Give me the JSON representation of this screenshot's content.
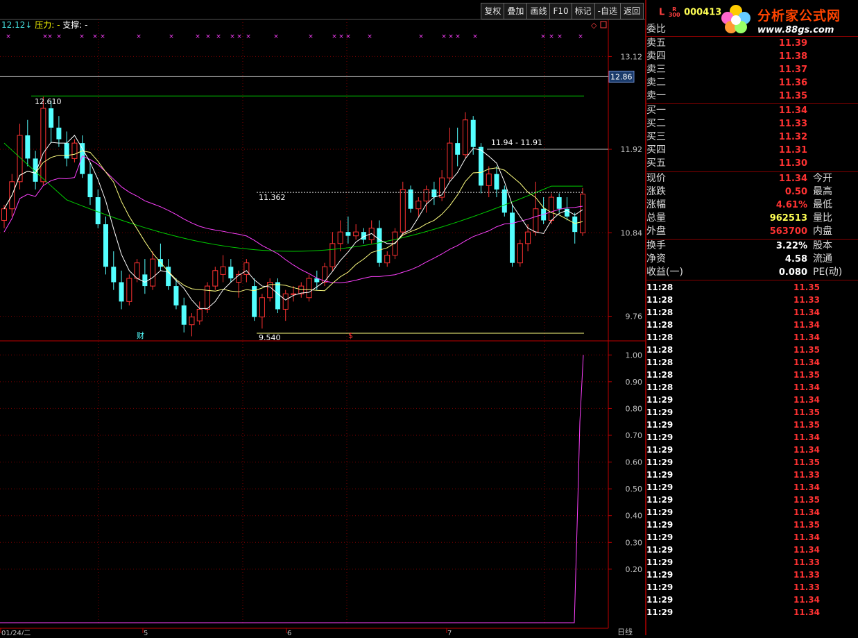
{
  "toolbar": [
    "复权",
    "叠加",
    "画线",
    "F10",
    "标记",
    "-自选",
    "返回"
  ],
  "legend": {
    "ma": "12.12↓",
    "pressure": "压力: -",
    "support": "支撑: -"
  },
  "markers": {
    "cai": "财",
    "dollar": "$"
  },
  "price_axis": [
    "13.12",
    "11.92",
    "10.84",
    "9.76"
  ],
  "current_price_tag": "12.86",
  "annotations": {
    "high": "12.610",
    "range": "11.94 - 11.91",
    "mid": "11.362",
    "low": "9.540"
  },
  "indicator_axis": [
    "1.00",
    "0.90",
    "0.80",
    "0.70",
    "0.60",
    "0.50",
    "0.40",
    "0.30",
    "0.20"
  ],
  "date_labels": [
    "01/24/二",
    "5",
    "6",
    "7"
  ],
  "period_label": "日线",
  "colors": {
    "up": "#ff3232",
    "down": "#54ffff",
    "ma5": "#ffffff",
    "ma10": "#ffff80",
    "ma20": "#ff40ff",
    "ma60": "#00cc00",
    "grid": "#800000"
  },
  "stock": {
    "prefix": "L",
    "badge_top": "R",
    "badge_bottom": "300",
    "code": "000413"
  },
  "logo": {
    "title": "分析家公式网",
    "url": "www.88gs.com"
  },
  "order_book": {
    "header": "委比",
    "sell": [
      {
        "label": "卖五",
        "price": "11.39"
      },
      {
        "label": "卖四",
        "price": "11.38"
      },
      {
        "label": "卖三",
        "price": "11.37"
      },
      {
        "label": "卖二",
        "price": "11.36"
      },
      {
        "label": "卖一",
        "price": "11.35"
      }
    ],
    "buy": [
      {
        "label": "买一",
        "price": "11.34"
      },
      {
        "label": "买二",
        "price": "11.33"
      },
      {
        "label": "买三",
        "price": "11.32"
      },
      {
        "label": "买四",
        "price": "11.31"
      },
      {
        "label": "买五",
        "price": "11.30"
      }
    ]
  },
  "quote": [
    {
      "label": "现价",
      "value": "11.34",
      "label2": "今开",
      "color": "#ff3232"
    },
    {
      "label": "涨跌",
      "value": "0.50",
      "label2": "最高",
      "color": "#ff3232"
    },
    {
      "label": "涨幅",
      "value": "4.61%",
      "label2": "最低",
      "color": "#ff3232"
    },
    {
      "label": "总量",
      "value": "962513",
      "label2": "量比",
      "color": "#ffff54"
    },
    {
      "label": "外盘",
      "value": "563700",
      "label2": "内盘",
      "color": "#ff3232"
    }
  ],
  "stats": [
    {
      "label": "换手",
      "value": "3.22%",
      "label2": "股本",
      "color": "#ffffff"
    },
    {
      "label": "净资",
      "value": "4.58",
      "label2": "流通",
      "color": "#ffffff"
    },
    {
      "label": "收益(一)",
      "value": "0.080",
      "label2": "PE(动)",
      "color": "#ffffff"
    }
  ],
  "ticks": [
    {
      "t": "11:28",
      "p": "11.35"
    },
    {
      "t": "11:28",
      "p": "11.33"
    },
    {
      "t": "11:28",
      "p": "11.34"
    },
    {
      "t": "11:28",
      "p": "11.34"
    },
    {
      "t": "11:28",
      "p": "11.34"
    },
    {
      "t": "11:28",
      "p": "11.35"
    },
    {
      "t": "11:28",
      "p": "11.34"
    },
    {
      "t": "11:28",
      "p": "11.35"
    },
    {
      "t": "11:28",
      "p": "11.34"
    },
    {
      "t": "11:29",
      "p": "11.34"
    },
    {
      "t": "11:29",
      "p": "11.35"
    },
    {
      "t": "11:29",
      "p": "11.35"
    },
    {
      "t": "11:29",
      "p": "11.34"
    },
    {
      "t": "11:29",
      "p": "11.34"
    },
    {
      "t": "11:29",
      "p": "11.35"
    },
    {
      "t": "11:29",
      "p": "11.33"
    },
    {
      "t": "11:29",
      "p": "11.34"
    },
    {
      "t": "11:29",
      "p": "11.35"
    },
    {
      "t": "11:29",
      "p": "11.34"
    },
    {
      "t": "11:29",
      "p": "11.35"
    },
    {
      "t": "11:29",
      "p": "11.34"
    },
    {
      "t": "11:29",
      "p": "11.34"
    },
    {
      "t": "11:29",
      "p": "11.33"
    },
    {
      "t": "11:29",
      "p": "11.33"
    },
    {
      "t": "11:29",
      "p": "11.33"
    },
    {
      "t": "11:29",
      "p": "11.34"
    },
    {
      "t": "11:29",
      "p": "11.34"
    }
  ],
  "chart_data": {
    "type": "candlestick",
    "price_ylim": [
      9.45,
      13.6
    ],
    "candles": [
      [
        11.0,
        11.2,
        10.9,
        11.15
      ],
      [
        11.15,
        11.6,
        11.05,
        11.5
      ],
      [
        11.5,
        12.25,
        11.4,
        12.1
      ],
      [
        12.1,
        12.3,
        11.7,
        11.8
      ],
      [
        11.8,
        11.9,
        11.4,
        11.5
      ],
      [
        11.5,
        12.6,
        11.45,
        12.45
      ],
      [
        12.45,
        12.55,
        12.0,
        12.2
      ],
      [
        12.2,
        12.35,
        11.95,
        12.05
      ],
      [
        12.0,
        12.15,
        11.7,
        11.8
      ],
      [
        11.8,
        12.05,
        11.75,
        12.0
      ],
      [
        12.0,
        12.1,
        11.55,
        11.6
      ],
      [
        11.6,
        11.75,
        11.2,
        11.3
      ],
      [
        11.3,
        11.4,
        10.9,
        10.95
      ],
      [
        10.95,
        11.05,
        10.3,
        10.4
      ],
      [
        10.4,
        10.6,
        10.1,
        10.2
      ],
      [
        10.2,
        10.35,
        9.85,
        9.95
      ],
      [
        9.95,
        10.3,
        9.9,
        10.25
      ],
      [
        10.25,
        10.5,
        10.2,
        10.45
      ],
      [
        10.3,
        10.5,
        10.05,
        10.15
      ],
      [
        10.15,
        10.6,
        10.1,
        10.5
      ],
      [
        10.5,
        10.7,
        10.35,
        10.4
      ],
      [
        10.4,
        10.5,
        10.1,
        10.15
      ],
      [
        10.15,
        10.25,
        9.85,
        9.9
      ],
      [
        9.9,
        10.0,
        9.55,
        9.65
      ],
      [
        9.65,
        9.8,
        9.5,
        9.75
      ],
      [
        9.7,
        9.95,
        9.65,
        9.85
      ],
      [
        9.85,
        10.2,
        9.8,
        10.15
      ],
      [
        10.15,
        10.4,
        10.1,
        10.35
      ],
      [
        10.3,
        10.55,
        10.2,
        10.4
      ],
      [
        10.4,
        10.5,
        10.2,
        10.25
      ],
      [
        10.2,
        10.35,
        10.0,
        10.3
      ],
      [
        10.3,
        10.5,
        10.2,
        10.45
      ],
      [
        10.15,
        10.25,
        9.7,
        9.75
      ],
      [
        9.75,
        10.05,
        9.6,
        10.0
      ],
      [
        10.0,
        10.25,
        9.95,
        10.2
      ],
      [
        10.2,
        10.25,
        9.8,
        9.85
      ],
      [
        9.85,
        10.1,
        9.7,
        10.05
      ],
      [
        10.05,
        10.15,
        9.95,
        10.05
      ],
      [
        10.05,
        10.2,
        10.0,
        10.15
      ],
      [
        10.0,
        10.3,
        9.95,
        10.25
      ],
      [
        10.25,
        10.35,
        10.1,
        10.2
      ],
      [
        10.2,
        10.45,
        10.15,
        10.4
      ],
      [
        10.4,
        10.85,
        10.35,
        10.7
      ],
      [
        10.7,
        11.0,
        10.6,
        10.85
      ],
      [
        10.85,
        11.05,
        10.7,
        10.8
      ],
      [
        10.8,
        10.95,
        10.75,
        10.85
      ],
      [
        10.85,
        10.9,
        10.7,
        10.75
      ],
      [
        10.75,
        11.0,
        10.7,
        10.9
      ],
      [
        10.9,
        11.0,
        10.4,
        10.45
      ],
      [
        10.45,
        10.6,
        10.4,
        10.55
      ],
      [
        10.55,
        10.9,
        10.5,
        10.85
      ],
      [
        10.85,
        11.5,
        10.8,
        11.4
      ],
      [
        11.4,
        11.45,
        11.1,
        11.15
      ],
      [
        11.15,
        11.3,
        11.05,
        11.25
      ],
      [
        11.25,
        11.45,
        11.1,
        11.4
      ],
      [
        11.4,
        11.5,
        11.2,
        11.3
      ],
      [
        11.3,
        11.65,
        11.25,
        11.55
      ],
      [
        11.55,
        12.2,
        11.5,
        12.0
      ],
      [
        12.0,
        12.2,
        11.7,
        11.85
      ],
      [
        11.85,
        12.4,
        11.8,
        12.3
      ],
      [
        12.3,
        12.35,
        11.85,
        11.95
      ],
      [
        11.95,
        12.0,
        11.35,
        11.45
      ],
      [
        11.45,
        11.7,
        11.3,
        11.6
      ],
      [
        11.6,
        11.7,
        11.3,
        11.4
      ],
      [
        11.4,
        11.45,
        11.05,
        11.1
      ],
      [
        11.1,
        11.2,
        10.4,
        10.45
      ],
      [
        10.45,
        10.75,
        10.4,
        10.7
      ],
      [
        10.7,
        10.95,
        10.6,
        10.85
      ],
      [
        10.85,
        11.5,
        10.8,
        11.15
      ],
      [
        11.15,
        11.3,
        10.95,
        11.0
      ],
      [
        11.0,
        11.35,
        10.95,
        11.3
      ],
      [
        11.3,
        11.35,
        11.1,
        11.15
      ],
      [
        11.15,
        11.3,
        11.0,
        11.05
      ],
      [
        11.05,
        11.1,
        10.7,
        10.85
      ],
      [
        10.84,
        11.42,
        10.8,
        11.34
      ]
    ],
    "horizontal_lines": [
      12.86,
      12.61,
      11.92,
      11.362,
      9.54
    ],
    "indicator_ylim": [
      0.0,
      1.05
    ]
  }
}
